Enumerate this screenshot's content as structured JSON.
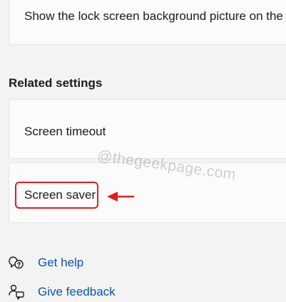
{
  "lock_screen": {
    "label": "Show the lock screen background picture on the"
  },
  "related_settings": {
    "heading": "Related settings",
    "items": [
      {
        "label": "Screen timeout"
      },
      {
        "label": "Screen saver"
      }
    ]
  },
  "watermark": "@thegeekpage.com",
  "links": {
    "help": {
      "label": "Get help",
      "icon": "help-chat-icon"
    },
    "feedback": {
      "label": "Give feedback",
      "icon": "feedback-icon"
    }
  },
  "colors": {
    "highlight": "#e0201d",
    "link": "#0a55a8",
    "card_bg": "#fbfbfb",
    "page_bg": "#f3f3f3"
  }
}
